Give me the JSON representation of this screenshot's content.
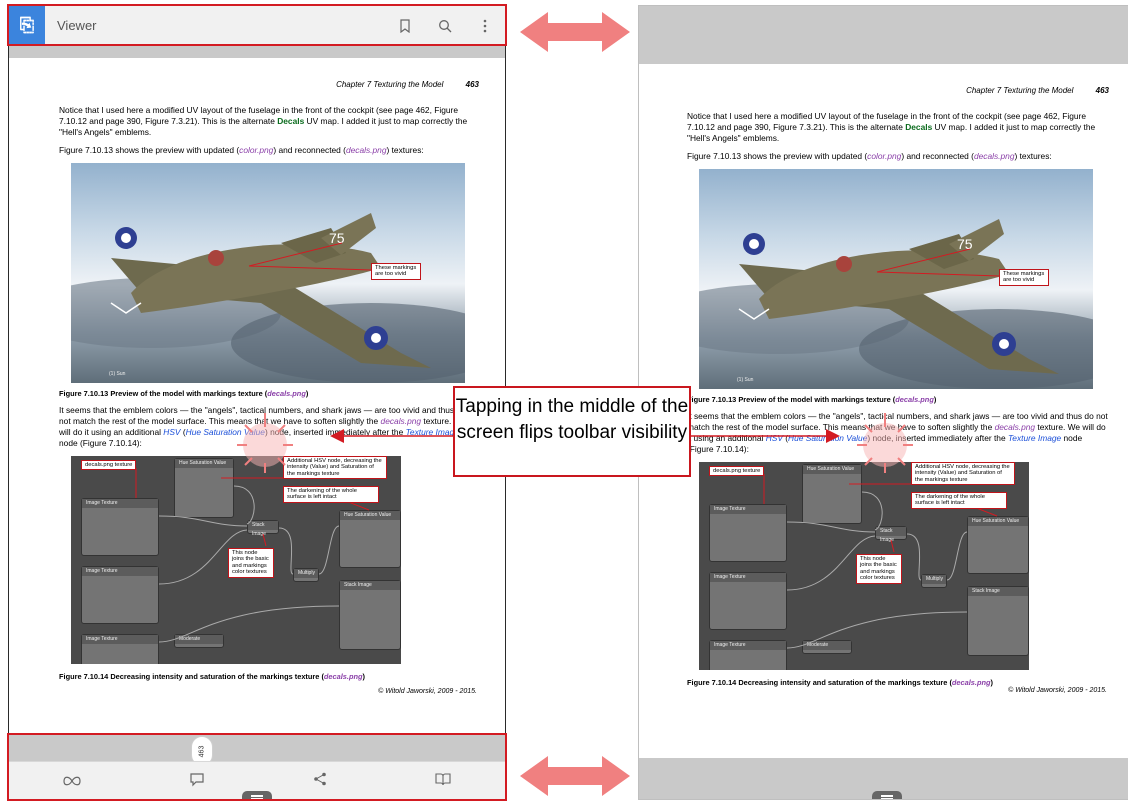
{
  "toolbar": {
    "title": "Viewer"
  },
  "page": {
    "header_chapter": "Chapter 7 Texturing the Model",
    "header_number": "463",
    "para1_a": "Notice that I used here a modified UV layout of the fuselage in the front of the cockpit (see page 462, Figure 7.10.12 and page 390, Figure 7.3.21). This is the alternate ",
    "para1_decals": "Decals",
    "para1_b": " UV map. I added it just to map correctly the \"Hell's Angels\" emblems.",
    "para2_a": "Figure 7.10.13 shows the preview with updated (",
    "para2_color": "color.png",
    "para2_b": ") and reconnected (",
    "para2_decals": "decals.png",
    "para2_c": ") textures:",
    "fig1_note": "These markings are too vivid",
    "fig1_sun": "(1) Sun",
    "caption1_a": "Figure 7.10.13 Preview of the model with markings texture (",
    "caption1_file": "decals.png",
    "caption1_b": ")",
    "para3_a": "It seems that the emblem colors — the \"angels\", tactical numbers, and shark jaws — are too vivid and thus do not match the rest of the model surface. This means that we have to soften slightly the ",
    "para3_file": "decals.png",
    "para3_b": " texture. We will do it using an additional ",
    "para3_hsv": "HSV",
    "para3_c": " (",
    "para3_hsvfull": "Hue Saturation Value",
    "para3_d": ") node, inserted immediately after the ",
    "para3_texnode": "Texture Image",
    "para3_e": " node (Figure 7.10.14):",
    "note_decals": "decals.png texture",
    "note_hsv": "Additional HSV node, decreasing the intensity (Value) and Saturation of the markings texture",
    "note_darken": "The darkening of the whole surface is left intact",
    "note_joins": "This node joins the basic and markings color textures",
    "caption2_a": "Figure 7.10.14 Decreasing intensity and saturation of the markings texture (",
    "caption2_file": "decals.png",
    "caption2_b": ")",
    "copyright": "© Witold Jaworski, 2009 - 2015."
  },
  "page_tab": "463",
  "callout": "Tapping in the middle of the screen flips toolbar visibility",
  "nodes": {
    "hsv": "Hue Saturation Value",
    "image_texture": "Image Texture",
    "mix": "Stack Image",
    "multiply": "Multiply",
    "moderate": "Moderate",
    "gloss": "Gloss Paint"
  },
  "colors": {
    "accent": "#3b84dd",
    "highlight": "#d31b22",
    "arrow": "#f08080"
  },
  "icons": [
    "app-icon",
    "bookmark-icon",
    "search-icon",
    "more-icon",
    "infinity-icon",
    "comment-icon",
    "share-icon",
    "book-icon",
    "drawer-handle-icon"
  ]
}
